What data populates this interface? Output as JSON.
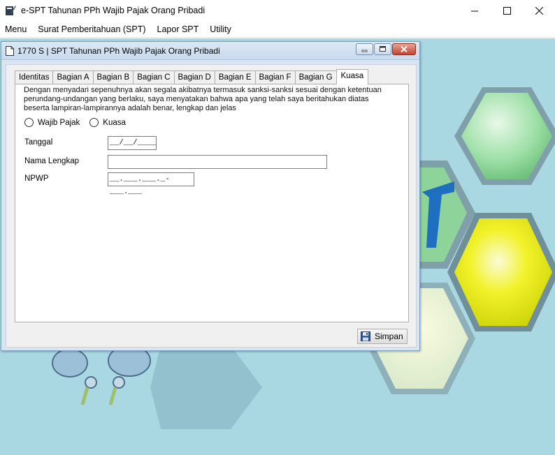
{
  "app": {
    "title": "e-SPT Tahunan PPh Wajib Pajak Orang Pribadi"
  },
  "menubar": {
    "items": [
      "Menu",
      "Surat Pemberitahuan (SPT)",
      "Lapor SPT",
      "Utility"
    ]
  },
  "child_window": {
    "title": "1770 S | SPT Tahunan PPh Wajib Pajak Orang Pribadi"
  },
  "tabs": [
    "Identitas",
    "Bagian A",
    "Bagian B",
    "Bagian C",
    "Bagian D",
    "Bagian E",
    "Bagian F",
    "Bagian G",
    "Kuasa"
  ],
  "active_tab": "Kuasa",
  "declaration": "Dengan menyadari sepenuhnya akan segala akibatnya termasuk sanksi-sanksi sesuai dengan ketentuan perundang-undangan yang berlaku, saya menyatakan bahwa apa yang telah saya beritahukan diatas beserta lampiran-lampirannya adalah benar, lengkap dan jelas",
  "radio_options": [
    "Wajib Pajak",
    "Kuasa"
  ],
  "form": {
    "tanggal_label": "Tanggal",
    "tanggal_value": "__/__/____",
    "nama_label": "Nama Lengkap",
    "nama_value": "",
    "npwp_label": "NPWP",
    "npwp_value": "__.___.___._-___.___"
  },
  "buttons": {
    "save": "Simpan"
  },
  "icons": [
    "app-icon",
    "minimize-icon",
    "maximize-icon",
    "close-icon",
    "document-icon",
    "floppy-disk-icon"
  ]
}
